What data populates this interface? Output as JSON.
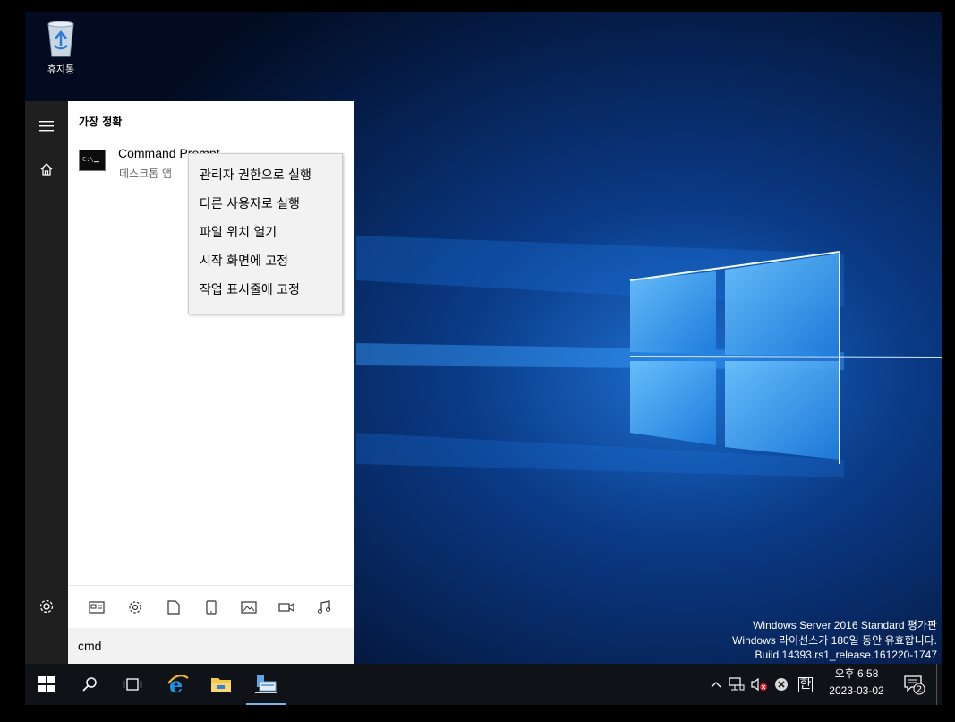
{
  "desktop": {
    "recycle_bin_label": "휴지통",
    "watermark": {
      "line1": "Windows Server 2016 Standard 평가판",
      "line2": "Windows 라이선스가 180일 동안 유효합니다.",
      "line3": "Build 14393.rs1_release.161220-1747"
    }
  },
  "start_menu": {
    "section_title": "가장 정확",
    "result": {
      "name": "Command Prompt",
      "subtitle": "데스크톱 앱",
      "icon": "cmd-icon"
    },
    "context_menu": [
      "관리자 권한으로 실행",
      "다른 사용자로 실행",
      "파일 위치 열기",
      "시작 화면에 고정",
      "작업 표시줄에 고정"
    ],
    "quick_filters": [
      "apps-icon",
      "settings-icon",
      "documents-icon",
      "device-icon",
      "photos-icon",
      "videos-icon",
      "music-icon"
    ],
    "search_value": "cmd"
  },
  "taskbar": {
    "apps": [
      "start-icon",
      "search-icon",
      "task-view-icon",
      "internet-explorer-icon",
      "file-explorer-icon",
      "server-manager-icon"
    ],
    "tray": {
      "ime": "한",
      "time": "오후 6:58",
      "date": "2023-03-02",
      "notification_count": "2"
    }
  },
  "colors": {
    "accent": "#76b9ed",
    "rail": "#1f1f1f",
    "taskbar": "#0f1217"
  }
}
